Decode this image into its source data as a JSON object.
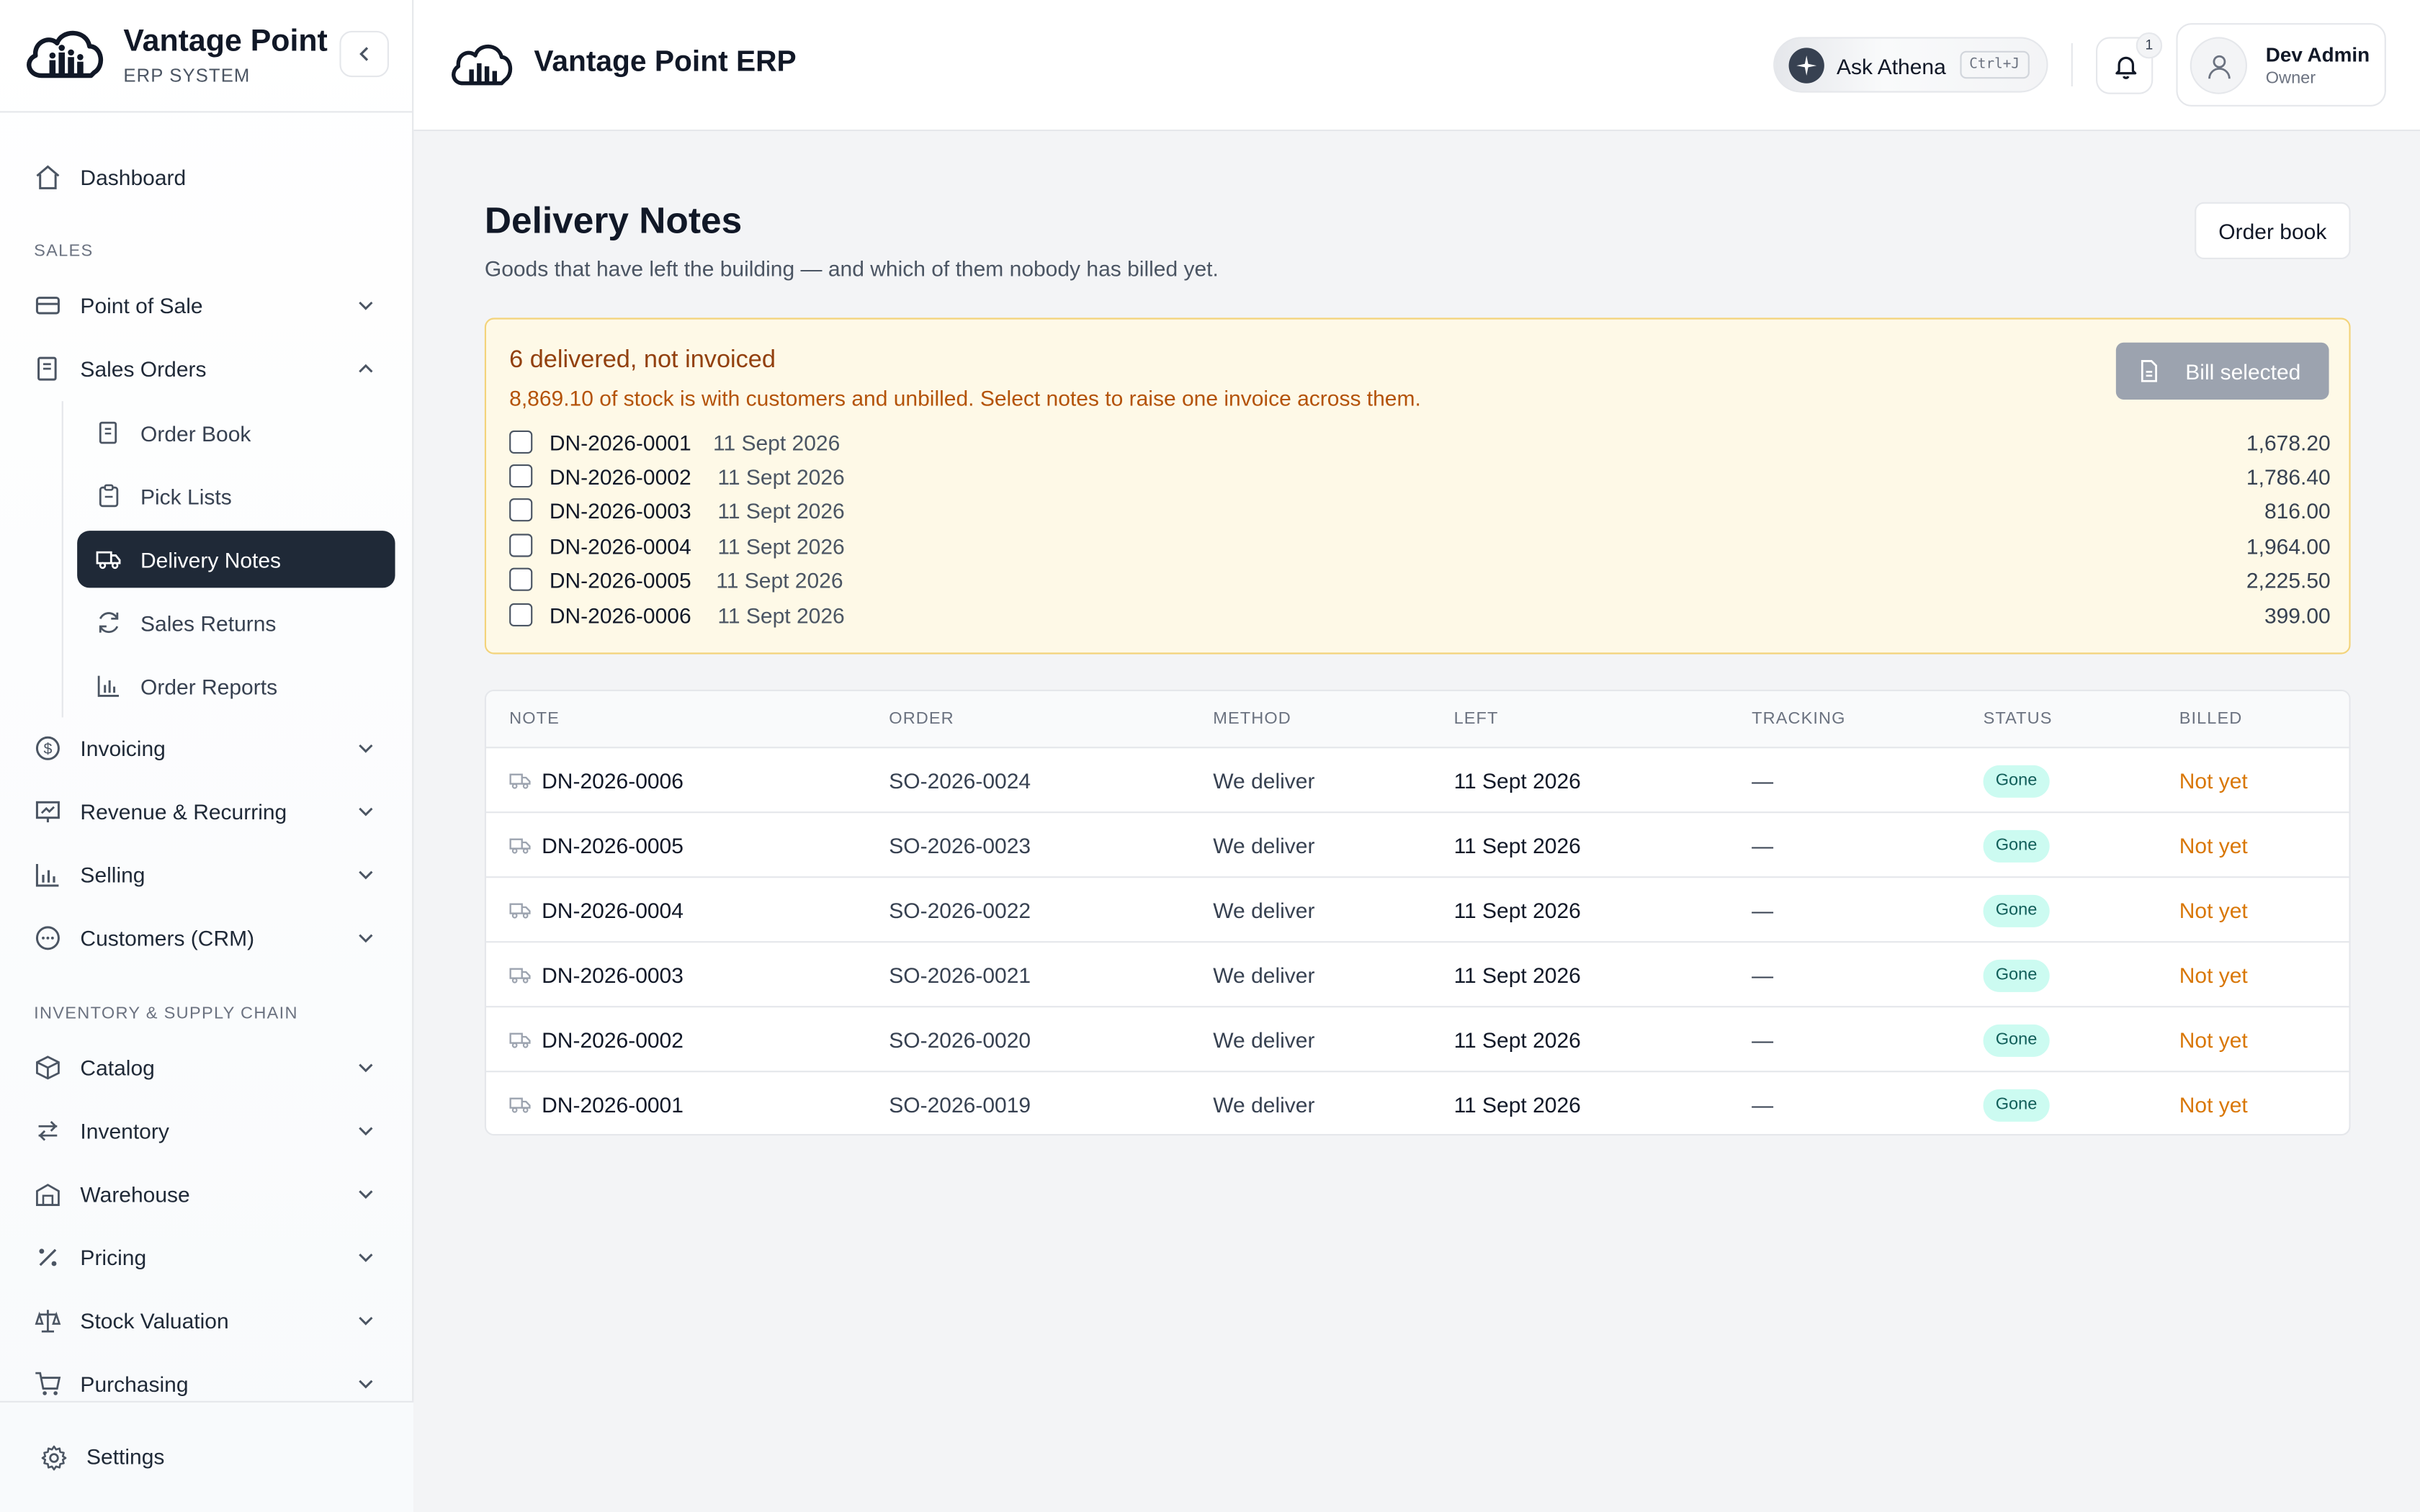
{
  "brand": {
    "name": "Vantage Point",
    "subtitle": "ERP SYSTEM"
  },
  "sidebar": {
    "dashboard": "Dashboard",
    "sales_section": "SALES",
    "point_of_sale": "Point of Sale",
    "sales_orders": "Sales Orders",
    "sales_orders_children": [
      {
        "label": "Order Book",
        "icon": "order-book-icon"
      },
      {
        "label": "Pick Lists",
        "icon": "clipboard-icon"
      },
      {
        "label": "Delivery Notes",
        "icon": "truck-icon",
        "active": true
      },
      {
        "label": "Sales Returns",
        "icon": "refresh-icon"
      },
      {
        "label": "Order Reports",
        "icon": "bar-chart-icon"
      }
    ],
    "invoicing": "Invoicing",
    "revenue": "Revenue & Recurring",
    "selling": "Selling",
    "crm": "Customers (CRM)",
    "inventory_section": "INVENTORY & SUPPLY CHAIN",
    "catalog": "Catalog",
    "inventory": "Inventory",
    "warehouse": "Warehouse",
    "pricing": "Pricing",
    "stock_valuation": "Stock Valuation",
    "purchasing": "Purchasing",
    "settings": "Settings"
  },
  "topbar": {
    "title": "Vantage Point ERP",
    "ask_label": "Ask Athena",
    "ask_shortcut": "Ctrl+J",
    "notification_count": "1",
    "user_name": "Dev Admin",
    "user_role": "Owner"
  },
  "page": {
    "title": "Delivery Notes",
    "subtitle": "Goods that have left the building — and which of them nobody has billed yet.",
    "order_book_button": "Order book"
  },
  "alert": {
    "title": "6 delivered, not invoiced",
    "description": "8,869.10 of stock is with customers and unbilled. Select notes to raise one invoice across them.",
    "bill_button": "Bill selected",
    "notes": [
      {
        "id": "DN-2026-0001",
        "date": "11 Sept 2026",
        "amount": "1,678.20",
        "checked": false
      },
      {
        "id": "DN-2026-0002",
        "date": "11 Sept 2026",
        "amount": "1,786.40",
        "checked": false
      },
      {
        "id": "DN-2026-0003",
        "date": "11 Sept 2026",
        "amount": "816.00",
        "checked": false
      },
      {
        "id": "DN-2026-0004",
        "date": "11 Sept 2026",
        "amount": "1,964.00",
        "checked": false
      },
      {
        "id": "DN-2026-0005",
        "date": "11 Sept 2026",
        "amount": "2,225.50",
        "checked": false
      },
      {
        "id": "DN-2026-0006",
        "date": "11 Sept 2026",
        "amount": "399.00",
        "checked": false
      }
    ]
  },
  "table": {
    "headers": [
      "NOTE",
      "ORDER",
      "METHOD",
      "LEFT",
      "TRACKING",
      "STATUS",
      "BILLED"
    ],
    "rows": [
      {
        "note": "DN-2026-0006",
        "order": "SO-2026-0024",
        "method": "We deliver",
        "left": "11 Sept 2026",
        "tracking": "—",
        "status": "Gone",
        "billed": "Not yet"
      },
      {
        "note": "DN-2026-0005",
        "order": "SO-2026-0023",
        "method": "We deliver",
        "left": "11 Sept 2026",
        "tracking": "—",
        "status": "Gone",
        "billed": "Not yet"
      },
      {
        "note": "DN-2026-0004",
        "order": "SO-2026-0022",
        "method": "We deliver",
        "left": "11 Sept 2026",
        "tracking": "—",
        "status": "Gone",
        "billed": "Not yet"
      },
      {
        "note": "DN-2026-0003",
        "order": "SO-2026-0021",
        "method": "We deliver",
        "left": "11 Sept 2026",
        "tracking": "—",
        "status": "Gone",
        "billed": "Not yet"
      },
      {
        "note": "DN-2026-0002",
        "order": "SO-2026-0020",
        "method": "We deliver",
        "left": "11 Sept 2026",
        "tracking": "—",
        "status": "Gone",
        "billed": "Not yet"
      },
      {
        "note": "DN-2026-0001",
        "order": "SO-2026-0019",
        "method": "We deliver",
        "left": "11 Sept 2026",
        "tracking": "—",
        "status": "Gone",
        "billed": "Not yet"
      }
    ]
  },
  "colors": {
    "active_nav": "#1f2937",
    "alert_bg": "#fef9e7",
    "alert_text": "#b45309",
    "status_badge": "#ccfbf1",
    "billed_text": "#d97706"
  }
}
